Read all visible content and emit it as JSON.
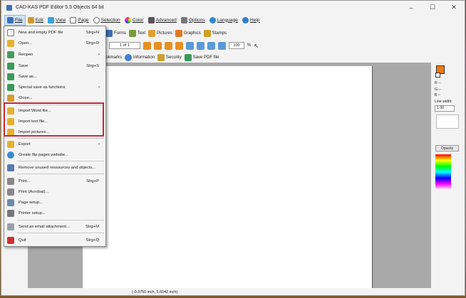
{
  "window": {
    "title": "CAD-KAS PDF Editor 5.5 Objects 64 bit",
    "min": "–",
    "max": "☐",
    "close": "✕"
  },
  "menubar": [
    {
      "label": "File",
      "color": "#3d6fb6"
    },
    {
      "label": "Edit",
      "color": "#d09a30"
    },
    {
      "label": "View",
      "color": "#3aa0d8"
    },
    {
      "label": "Page",
      "color": "#ffffff"
    },
    {
      "label": "Selection",
      "color": "#ffffff"
    },
    {
      "label": "Color",
      "color": "#e06ab0"
    },
    {
      "label": "Advanced",
      "color": "#555555"
    },
    {
      "label": "Options",
      "color": "#777777"
    },
    {
      "label": "Language",
      "color": "#2f88cc"
    },
    {
      "label": "Help",
      "color": "#2f7fd0"
    }
  ],
  "toolbar1": [
    "Forms",
    "Text",
    "Pictures",
    "Graphics",
    "Stamps"
  ],
  "toolbar2": {
    "page_value": "1 of 1",
    "zoom_value": "100",
    "zoom_unit": "%"
  },
  "toolbar3": [
    "Bookmarks",
    "Information",
    "Security",
    "Save PDF file"
  ],
  "file_menu": [
    {
      "label": "New and empty PDF file",
      "shortcut": "Strg+N"
    },
    {
      "label": "Open...",
      "shortcut": "Strg+O"
    },
    {
      "label": "Reopen",
      "submenu": true
    },
    {
      "label": "Save",
      "shortcut": "Strg+S"
    },
    {
      "label": "Save as..."
    },
    {
      "label": "Special save as functions",
      "submenu": true
    },
    {
      "label": "Close..."
    },
    {
      "label": "Import Word file..."
    },
    {
      "label": "Import text file..."
    },
    {
      "label": "Import pictures..."
    },
    {
      "label": "Export",
      "submenu": true
    },
    {
      "label": "Create flip pages website..."
    },
    {
      "label": "Remove unused ressources and objects..."
    },
    {
      "label": "Print...",
      "shortcut": "Strg+P"
    },
    {
      "label": "Print (Acrobat)..."
    },
    {
      "label": "Page setup..."
    },
    {
      "label": "Printer setup..."
    },
    {
      "label": "Send as email attachment...",
      "shortcut": "Strg+M"
    },
    {
      "label": "Quit",
      "shortcut": "Strg+Q"
    }
  ],
  "right_panel": {
    "r": "R --",
    "g": "G --",
    "b": "B --",
    "line_width_label": "Line width:",
    "line_width_value": "1.00",
    "opacity": "Opacity"
  },
  "status": {
    "coords": "(-0.3750 inch, 5.6042 inch)"
  },
  "colors": {
    "highlight": "#c62a3a",
    "fill": "#f07a10",
    "accent": "#3d6fb6"
  }
}
